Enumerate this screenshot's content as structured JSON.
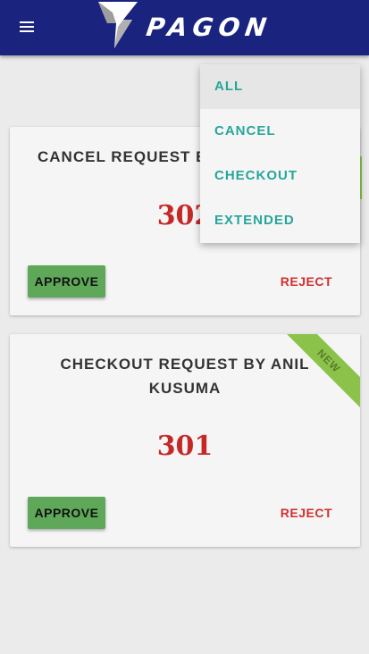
{
  "header": {
    "logo_text": "PAGON",
    "background_color": "#1a237e"
  },
  "filter_menu": {
    "items": [
      {
        "label": "ALL",
        "selected": true
      },
      {
        "label": "CANCEL",
        "selected": false
      },
      {
        "label": "CHECKOUT",
        "selected": false
      },
      {
        "label": "EXTENDED",
        "selected": false
      }
    ],
    "text_color": "#26a69a"
  },
  "requests": [
    {
      "title": "CANCEL REQUEST B",
      "number": "302",
      "approve_label": "APPROVE",
      "reject_label": "REJECT",
      "badge": ""
    },
    {
      "title": "CHECKOUT REQUEST BY ANIL KUSUMA",
      "number": "301",
      "approve_label": "APPROVE",
      "reject_label": "REJECT",
      "badge": "NEW"
    }
  ],
  "colors": {
    "approve": "#5fa85a",
    "reject": "#d32f2f",
    "number": "#c62828",
    "ribbon": "#8bc34a"
  }
}
